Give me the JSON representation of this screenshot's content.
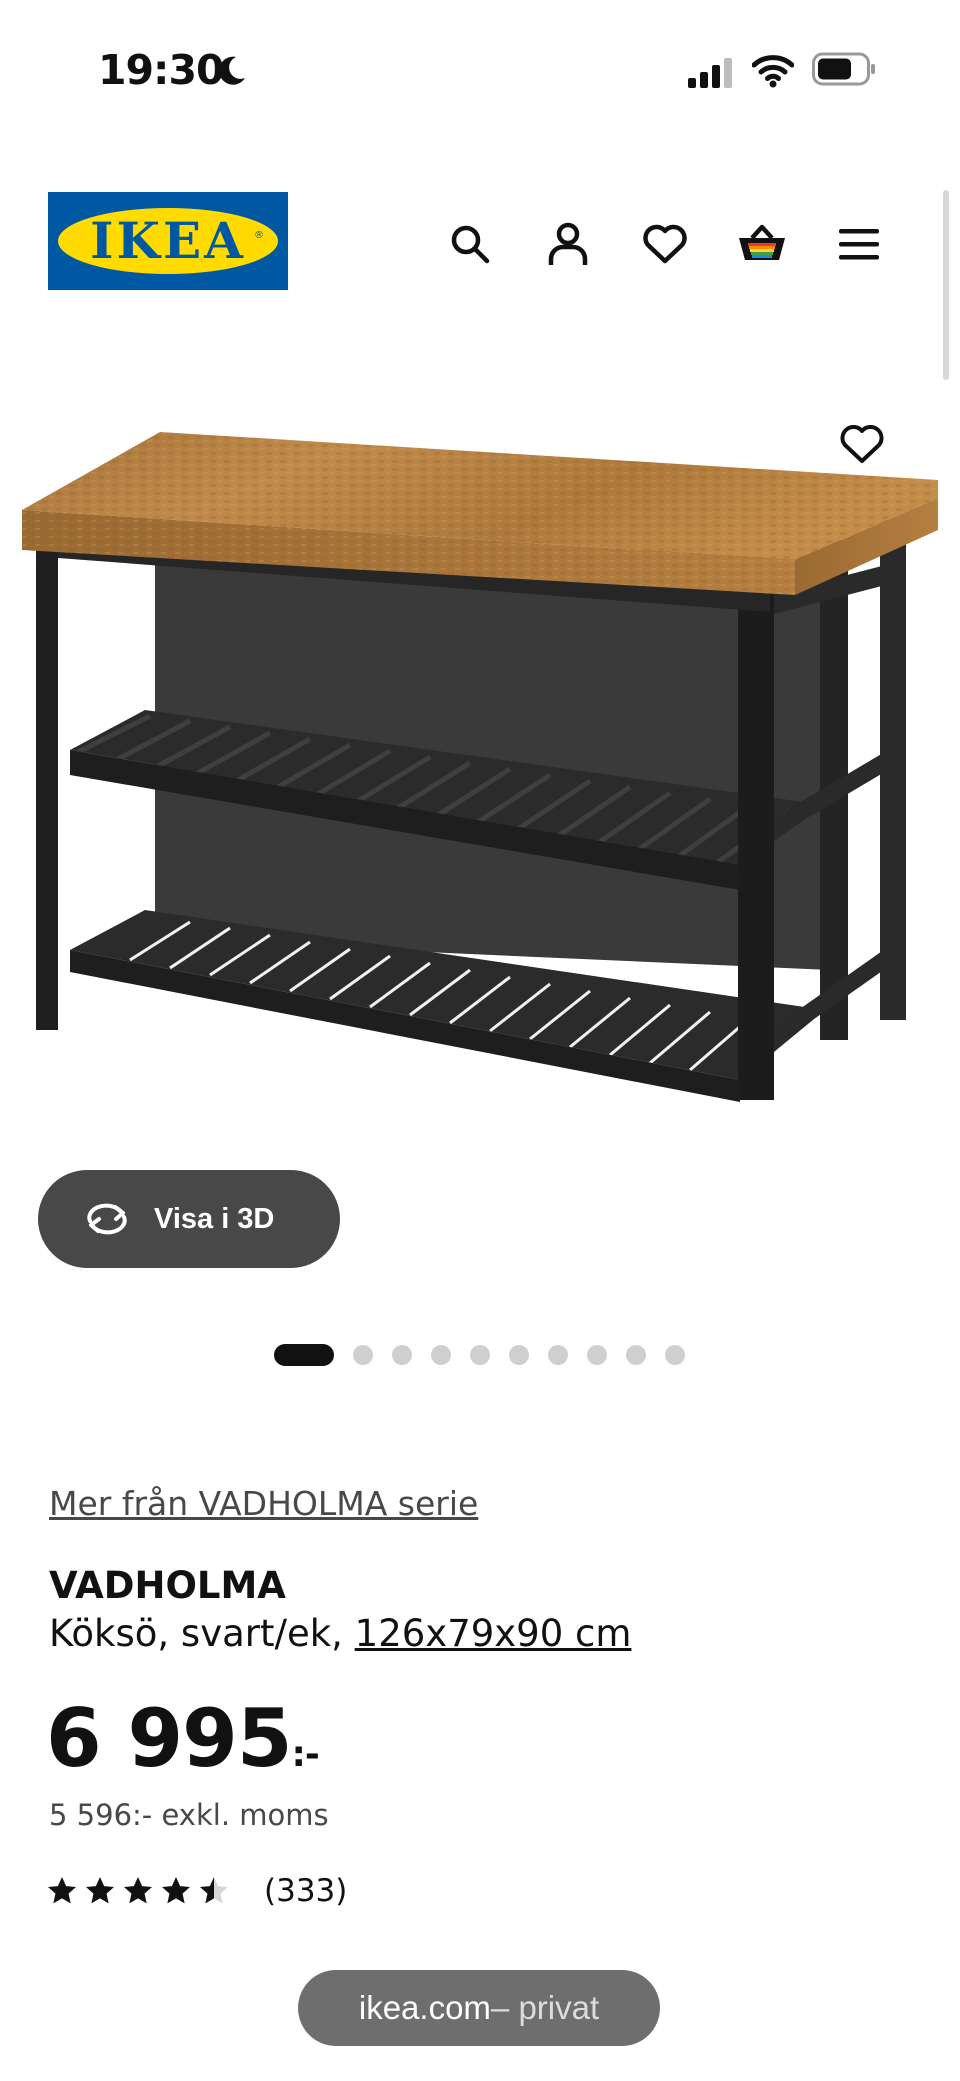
{
  "status_bar": {
    "time": "19:30"
  },
  "header": {
    "logo_text": "IKEA"
  },
  "media": {
    "view_3d_label": "Visa i 3D",
    "image_count": 10,
    "active_index": 0
  },
  "product": {
    "series_link": "Mer från VADHOLMA serie",
    "name": "VADHOLMA",
    "description": "Köksö, svart/ek, ",
    "dimensions": "126x79x90 cm",
    "price": "6 995",
    "price_suffix": ":-",
    "price_excl_vat": "5 596:- exkl. moms",
    "rating": 4.5,
    "review_count": "(333)"
  },
  "browser": {
    "domain": "ikea.com",
    "mode": " – privat"
  },
  "colors": {
    "ikea_blue": "#0058a3",
    "ikea_yellow": "#ffdb00",
    "text": "#111111",
    "pill": "#484848"
  }
}
